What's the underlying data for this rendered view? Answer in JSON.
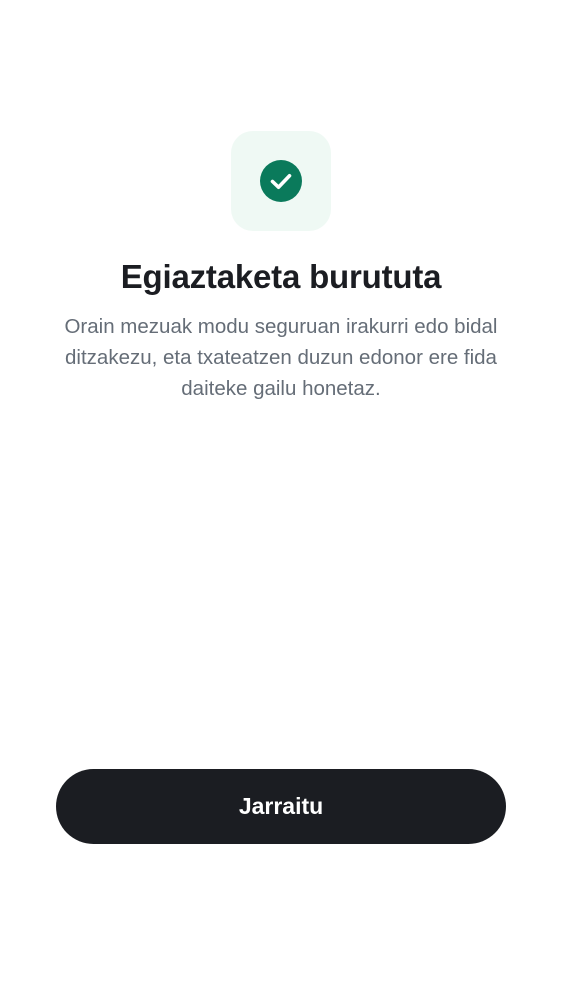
{
  "verification": {
    "icon": "check-circle-icon",
    "title": "Egiaztaketa burututa",
    "description": "Orain mezuak modu seguruan irakurri edo bidal ditzakezu, eta txateatzen duzun edonor ere fida daiteke gailu honetaz."
  },
  "actions": {
    "continue_label": "Jarraitu"
  },
  "colors": {
    "success": "#0a7a5b",
    "success_tile": "#eff9f4",
    "button_bg": "#1b1d22",
    "title": "#1b1d22",
    "body_text": "#656d77"
  }
}
